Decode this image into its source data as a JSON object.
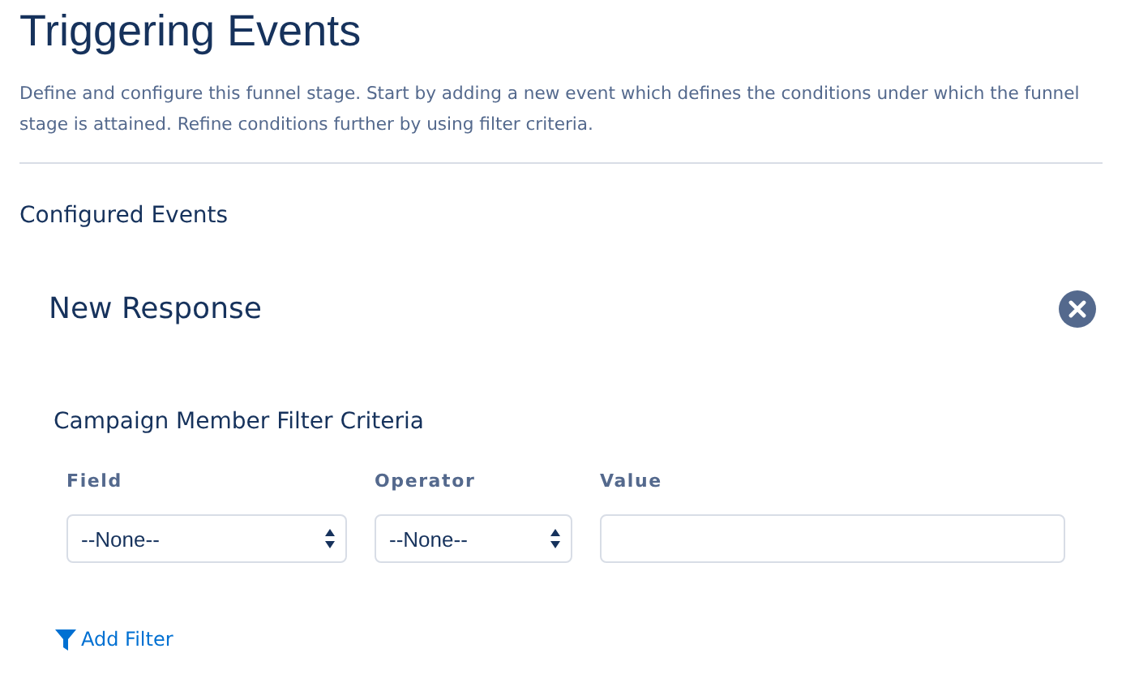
{
  "header": {
    "title": "Triggering Events",
    "description": "Define and configure this funnel stage. Start by adding a new event which defines the conditions under which the funnel stage is attained. Refine conditions further by using filter criteria."
  },
  "section_title": "Configured Events",
  "event": {
    "title": "New Response",
    "filter_heading": "Campaign Member Filter Criteria",
    "columns": [
      {
        "label": "Field",
        "kind": "select",
        "value": "--None--"
      },
      {
        "label": "Operator",
        "kind": "select",
        "value": "--None--"
      },
      {
        "label": "Value",
        "kind": "text"
      }
    ],
    "add_filter": "Add Filter"
  }
}
